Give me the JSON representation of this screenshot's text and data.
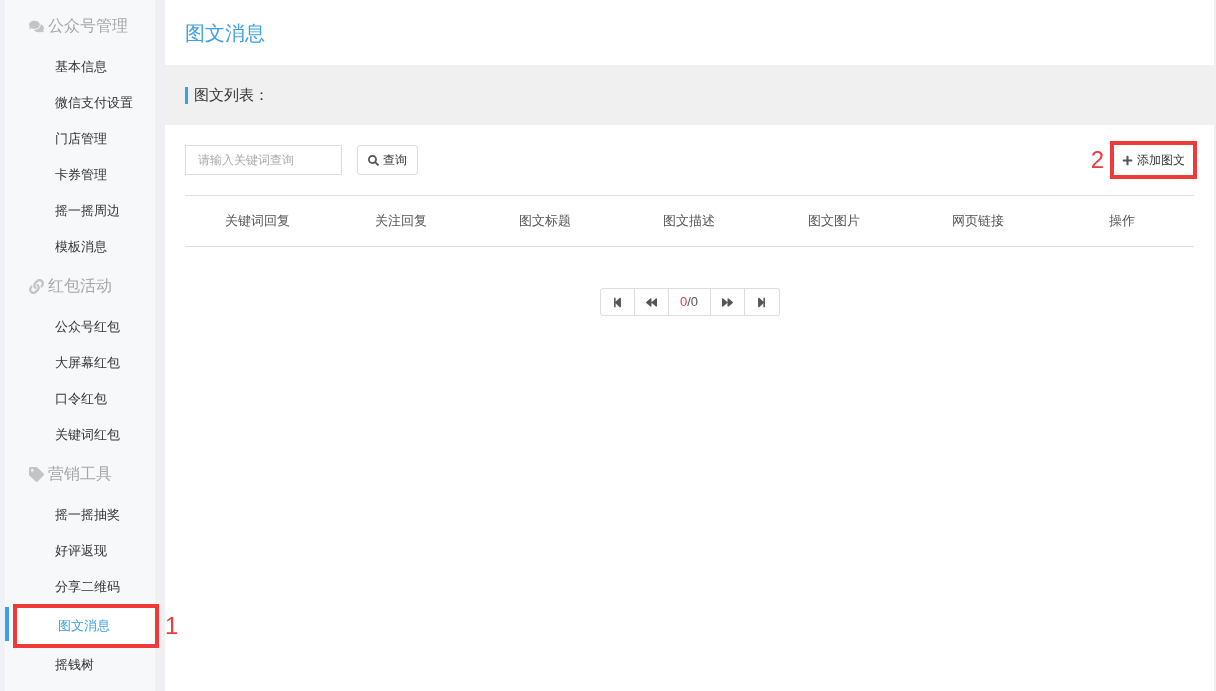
{
  "sidebar": {
    "groups": [
      {
        "title": "公众号管理",
        "kind": "chat",
        "items": [
          {
            "label": "基本信息",
            "selected": false
          },
          {
            "label": "微信支付设置",
            "selected": false
          },
          {
            "label": "门店管理",
            "selected": false
          },
          {
            "label": "卡券管理",
            "selected": false
          },
          {
            "label": "摇一摇周边",
            "selected": false
          },
          {
            "label": "模板消息",
            "selected": false
          }
        ]
      },
      {
        "title": "红包活动",
        "kind": "link",
        "items": [
          {
            "label": "公众号红包",
            "selected": false
          },
          {
            "label": "大屏幕红包",
            "selected": false
          },
          {
            "label": "口令红包",
            "selected": false
          },
          {
            "label": "关键词红包",
            "selected": false
          }
        ]
      },
      {
        "title": "营销工具",
        "kind": "tag",
        "items": [
          {
            "label": "摇一摇抽奖",
            "selected": false
          },
          {
            "label": "好评返现",
            "selected": false
          },
          {
            "label": "分享二维码",
            "selected": false
          },
          {
            "label": "图文消息",
            "selected": true,
            "callout": "1"
          },
          {
            "label": "摇钱树",
            "selected": false
          }
        ]
      }
    ]
  },
  "page_title": "图文消息",
  "section_title": "图文列表：",
  "search": {
    "placeholder": "请输入关键词查询",
    "button": "查询"
  },
  "add_button": {
    "label": "添加图文",
    "callout": "2"
  },
  "table": {
    "columns": [
      "关键词回复",
      "关注回复",
      "图文标题",
      "图文描述",
      "图文图片",
      "网页链接",
      "操作"
    ]
  },
  "pagination": {
    "current": "0",
    "total": "/0"
  }
}
